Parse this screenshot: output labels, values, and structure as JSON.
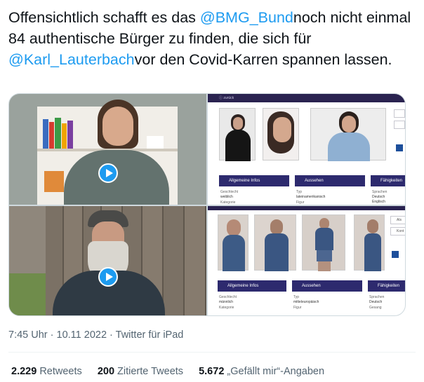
{
  "tweet": {
    "text_1": "Offensichtlich schafft es das ",
    "mention_1": "@BMG_Bund",
    "text_2": "noch nicht einmal 84 authentische Bürger zu finden, die sich für ",
    "mention_2": "@Karl_Lauterbach",
    "text_3": "vor den Covid-Karren spannen lassen."
  },
  "media": {
    "profile_1": {
      "top_label": "ⓘ zurück",
      "headings": [
        "Allgemeine Infos",
        "Aussehen",
        "Fähigkeiten"
      ],
      "fields": [
        "Geschlecht",
        "weiblich",
        "Kategorie",
        "Typ",
        "lateinamerikanisch",
        "Figur",
        "Sprachen",
        "Deutsch",
        "Englisch"
      ]
    },
    "profile_2": {
      "headings": [
        "Allgemeine Infos",
        "Aussehen",
        "Fähigkeiten"
      ],
      "fields": [
        "Geschlecht",
        "männlich",
        "Kategorie",
        "Typ",
        "mitteleuropäisch",
        "Figur",
        "Sprachen",
        "Deutsch",
        "Gesang"
      ],
      "side_buttons": [
        "Als",
        "Kont"
      ]
    }
  },
  "meta": {
    "time": "7:45 Uhr",
    "separator_1": " · ",
    "date": "10.11 2022",
    "separator_2": " · ",
    "source": "Twitter für iPad"
  },
  "stats": {
    "retweets_count": "2.229",
    "retweets_label": " Retweets",
    "quotes_count": "200",
    "quotes_label": " Zitierte Tweets",
    "likes_count": "5.672",
    "likes_label": " „Gefällt mir“-Angaben"
  },
  "colors": {
    "accent": "#1d9bf0",
    "text": "#0f1419",
    "secondary": "#536471",
    "profile_header": "#2d2a6e"
  },
  "icons": [
    "play-icon",
    "play-icon",
    "facebook-icon",
    "facebook-icon"
  ]
}
